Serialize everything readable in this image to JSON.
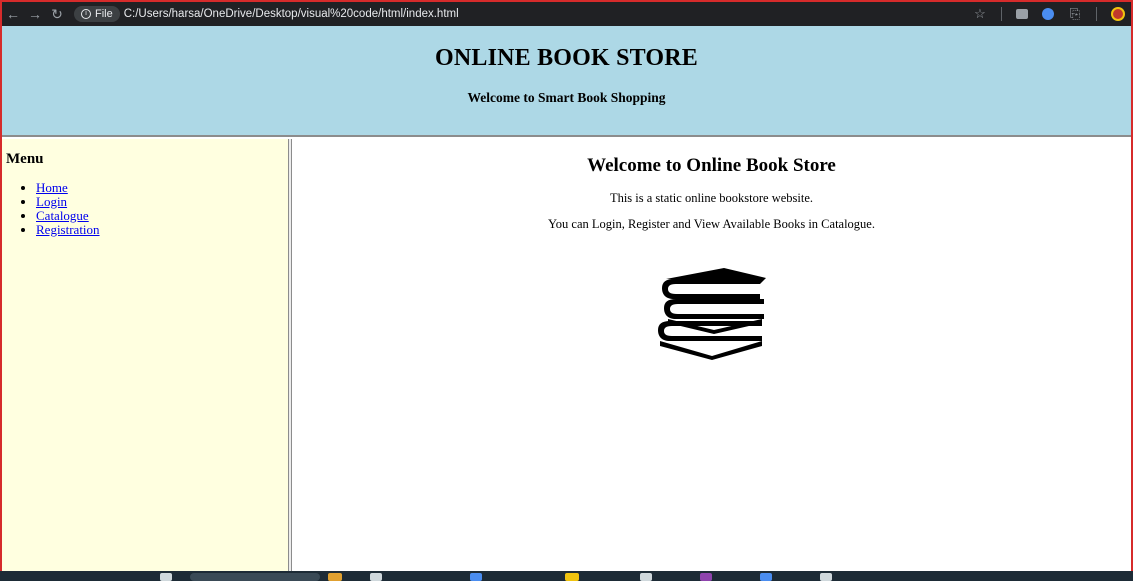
{
  "browser": {
    "nav": {
      "back_icon": "arrow-left-icon",
      "forward_icon": "arrow-right-icon",
      "reload_icon": "reload-icon"
    },
    "site_chip_label": "File",
    "url": "C:/Users/harsa/OneDrive/Desktop/visual%20code/html/index.html",
    "toolbar_icons": [
      "star-icon",
      "extension-icon",
      "extension-icon",
      "puzzle-icon",
      "profile-icon"
    ]
  },
  "header": {
    "title": "ONLINE BOOK STORE",
    "subtitle": "Welcome to Smart Book Shopping",
    "background": "#add8e6"
  },
  "sidebar": {
    "title": "Menu",
    "background": "#ffffe0",
    "items": [
      {
        "label": "Home"
      },
      {
        "label": "Login"
      },
      {
        "label": "Catalogue"
      },
      {
        "label": "Registration"
      }
    ]
  },
  "main": {
    "title": "Welcome to Online Book Store",
    "paragraph1": "This is a static online bookstore website.",
    "paragraph2": "You can Login, Register and View Available Books in Catalogue.",
    "image_icon": "books-icon"
  },
  "colors": {
    "link": "#0000ee",
    "frame_border": "#d62b2b",
    "toolbar_bg": "#202124"
  }
}
